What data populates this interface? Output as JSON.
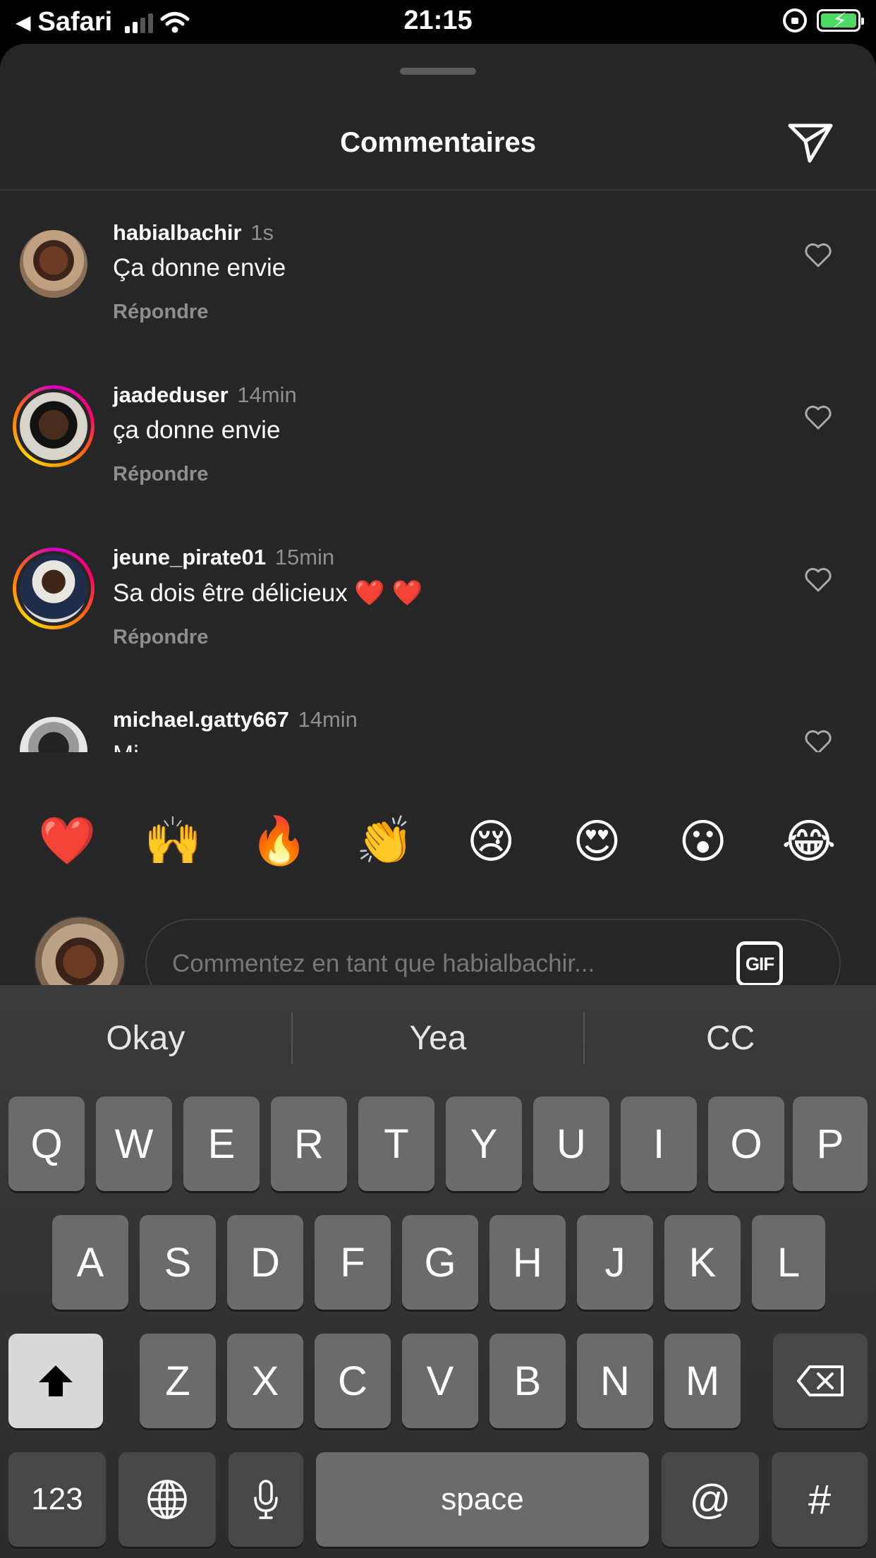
{
  "status_bar": {
    "back_label": "Safari",
    "time": "21:15"
  },
  "sheet": {
    "title": "Commentaires"
  },
  "comments": [
    {
      "user": "habialbachir",
      "time": "1s",
      "text": "Ça donne envie",
      "reply": "Répondre"
    },
    {
      "user": "jaadeduser",
      "time": "14min",
      "text": "ça donne envie",
      "reply": "Répondre"
    },
    {
      "user": "jeune_pirate01",
      "time": "15min",
      "text": "Sa dois être délicieux ❤️ ❤️",
      "reply": "Répondre"
    },
    {
      "user": "michael.gatty667",
      "time": "14min",
      "text": "Mi",
      "reply": ""
    }
  ],
  "emoji_bar": [
    "❤️",
    "🙌",
    "🔥",
    "👏",
    "😢",
    "😍",
    "😮",
    "😂"
  ],
  "compose": {
    "placeholder": "Commentez en tant que habialbachir...",
    "gif_label": "GIF"
  },
  "keyboard": {
    "predictions": [
      "Okay",
      "Yea",
      "CC"
    ],
    "row1": [
      "Q",
      "W",
      "E",
      "R",
      "T",
      "Y",
      "U",
      "I",
      "O",
      "P"
    ],
    "row2": [
      "A",
      "S",
      "D",
      "F",
      "G",
      "H",
      "J",
      "K",
      "L"
    ],
    "row3": [
      "Z",
      "X",
      "C",
      "V",
      "B",
      "N",
      "M"
    ],
    "numbers_label": "123",
    "space_label": "space",
    "at_label": "@",
    "hash_label": "#"
  }
}
